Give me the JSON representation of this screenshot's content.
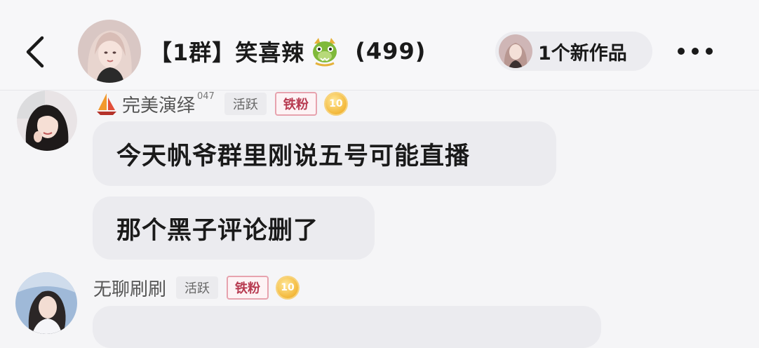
{
  "header": {
    "group_title": "【1群】笑喜辣",
    "member_count": "(499)",
    "new_works_label": "1个新作品"
  },
  "messages": [
    {
      "username": "完美演绎",
      "username_sup": "047",
      "active_badge": "活跃",
      "fan_badge": "铁粉",
      "level": "10",
      "bubbles": [
        "今天帆爷群里刚说五号可能直播",
        "那个黑子评论删了"
      ]
    },
    {
      "username": "无聊刷刷",
      "active_badge": "活跃",
      "fan_badge": "铁粉",
      "level": "10",
      "bubbles": []
    }
  ]
}
